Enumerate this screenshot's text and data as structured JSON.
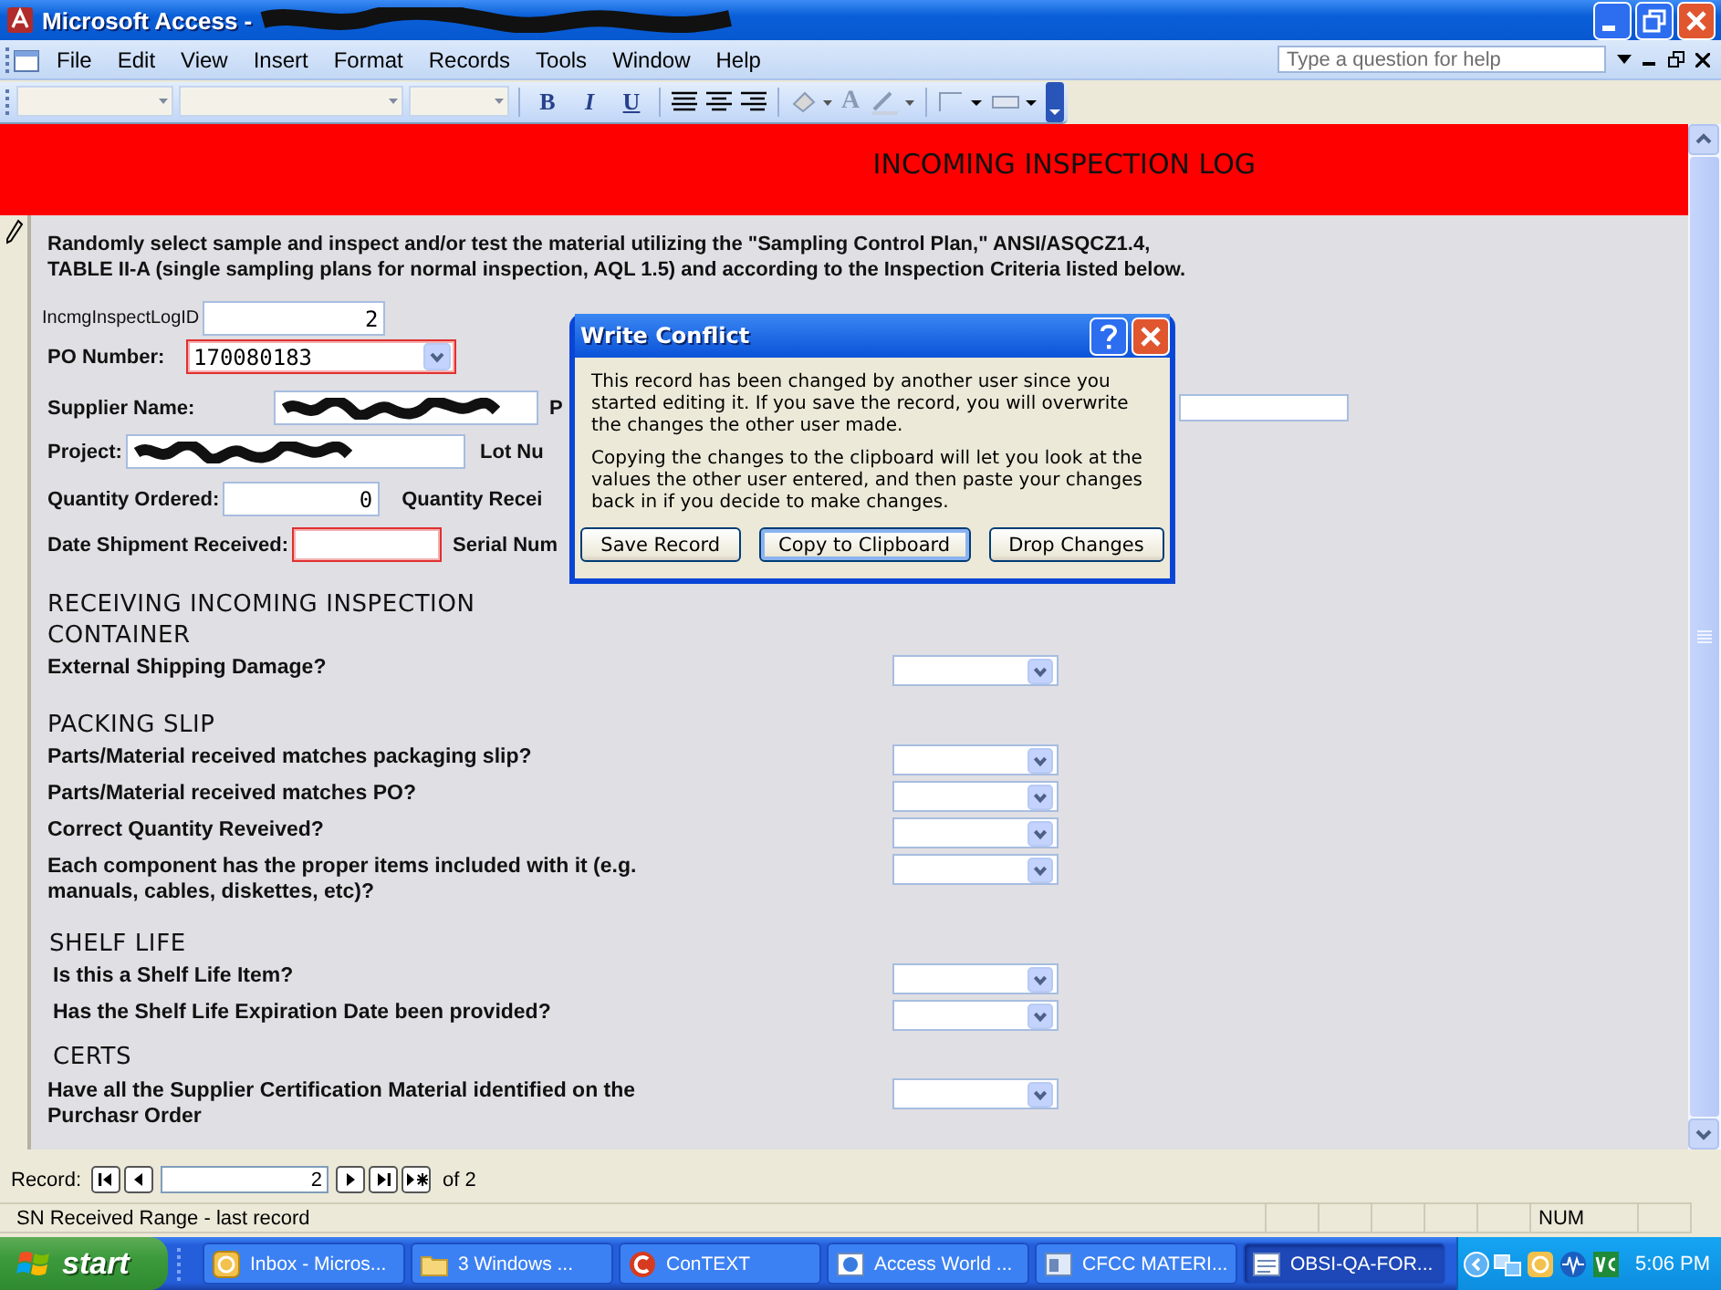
{
  "window": {
    "title": "Microsoft Access -",
    "help_placeholder": "Type a question for help"
  },
  "menu": [
    {
      "label": "File"
    },
    {
      "label": "Edit"
    },
    {
      "label": "View"
    },
    {
      "label": "Insert"
    },
    {
      "label": "Format"
    },
    {
      "label": "Records"
    },
    {
      "label": "Tools"
    },
    {
      "label": "Window"
    },
    {
      "label": "Help"
    }
  ],
  "toolbar": {
    "format_buttons": [
      "B",
      "I",
      "U"
    ],
    "font_color_glyph": "A"
  },
  "form": {
    "title": "INCOMING INSPECTION LOG",
    "instructions": "Randomly select sample and inspect and/or test the material utilizing the \"Sampling Control Plan,\" ANSI/ASQCZ1.4, TABLE II-A (single sampling plans for normal inspection, AQL 1.5) and according to the Inspection Criteria listed below.",
    "fields": [
      {
        "label": "IncmgInspectLogID",
        "kind": "number",
        "value": "2",
        "highlighted": false,
        "redacted": false,
        "side_field": false
      },
      {
        "label": "PO Number:",
        "kind": "combo",
        "value": "170080183",
        "highlighted": true,
        "redacted": false,
        "side_field": false
      },
      {
        "label": "Supplier Name:",
        "kind": "text",
        "highlighted": false,
        "redacted": true,
        "side_label": "P",
        "side_field": true
      },
      {
        "label": "Project:",
        "kind": "text",
        "highlighted": false,
        "redacted": true,
        "side_label": "Lot Nu",
        "side_field": false
      },
      {
        "label": "Quantity Ordered:",
        "kind": "number",
        "value": "0",
        "highlighted": false,
        "redacted": false,
        "side_label": "Quantity Recei",
        "side_field": false
      },
      {
        "label": "Date Shipment Received:",
        "kind": "text",
        "highlighted": true,
        "redacted": false,
        "side_label": "Serial Num",
        "side_field": false
      }
    ],
    "sections": [
      {
        "heading": "RECEIVING INCOMING INSPECTION"
      },
      {
        "heading": "CONTAINER",
        "items": [
          {
            "question": "External Shipping Damage?"
          }
        ]
      },
      {
        "heading": "PACKING SLIP",
        "items": [
          {
            "question": "Parts/Material received matches packaging slip?"
          },
          {
            "question": "Parts/Material received matches PO?"
          },
          {
            "question": "Correct Quantity Reveived?"
          },
          {
            "question": "Each component has the proper items included with it (e.g. manuals, cables, diskettes, etc)?"
          }
        ]
      },
      {
        "heading": "SHELF LIFE",
        "items": [
          {
            "question": "Is this a Shelf Life Item?"
          },
          {
            "question": "Has the Shelf Life Expiration Date been provided?"
          }
        ]
      },
      {
        "heading": "CERTS",
        "items": [
          {
            "question": "Have all the Supplier Certification Material identified on the Purchasr Order"
          }
        ]
      }
    ]
  },
  "dialog": {
    "title": "Write Conflict",
    "paragraphs": [
      "This record has been changed by another user since you started editing it.  If you save the record, you will overwrite the changes the other user made.",
      "Copying the changes to the clipboard will let you look at the values the other user entered, and then paste your changes back in if you decide to make changes."
    ],
    "buttons": [
      {
        "label": "Save Record",
        "focused": false
      },
      {
        "label": "Copy to Clipboard",
        "focused": true
      },
      {
        "label": "Drop Changes",
        "focused": false
      }
    ]
  },
  "record_nav": {
    "label": "Record:",
    "current": "2",
    "total_label": "of 2"
  },
  "status_bar": {
    "text": "SN Received Range - last record",
    "indicator": "NUM"
  },
  "taskbar": {
    "start": "start",
    "windows": [
      {
        "label": "Inbox - Micros...",
        "kind": "mail",
        "selected": false
      },
      {
        "label": "3 Windows ...",
        "kind": "folder",
        "selected": false
      },
      {
        "label": "ConTEXT",
        "kind": "editor",
        "selected": false
      },
      {
        "label": "Access World ...",
        "kind": "browser",
        "selected": false
      },
      {
        "label": "CFCC MATERI...",
        "kind": "explorer",
        "selected": false
      },
      {
        "label": "OBSI-QA-FOR...",
        "kind": "form",
        "selected": true
      }
    ],
    "clock": "5:06 PM"
  }
}
